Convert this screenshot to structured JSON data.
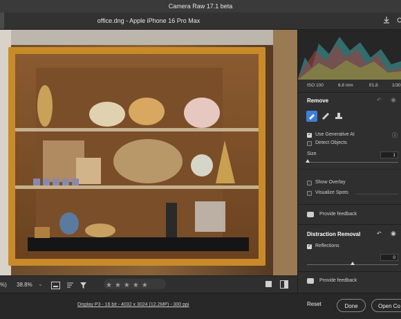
{
  "app": {
    "title": "Camera Raw 17.1 beta"
  },
  "document": {
    "title": "office.dng  -  Apple iPhone 16 Pro Max"
  },
  "exif": {
    "iso": "ISO 100",
    "focal": "6.8 mm",
    "aperture": "f/1.8",
    "shutter": "1/30"
  },
  "remove": {
    "title": "Remove",
    "use_generative_ai": "Use Generative AI",
    "detect_objects": "Detect Objects",
    "size_label": "Size",
    "size_value": "1",
    "show_overlay": "Show Overlay",
    "visualize_spots": "Visualize Spots",
    "feedback": "Provide feedback"
  },
  "distraction": {
    "title": "Distraction Removal",
    "reflections": "Reflections",
    "reflections_value": "0",
    "feedback": "Provide feedback"
  },
  "toolbar": {
    "zoom_partial": "%)",
    "zoom": "38.8%"
  },
  "rating": {
    "stars": "★★★★★"
  },
  "status": {
    "info": "Display P3 - 16 bit - 4032 x 3024 (12.2MP) - 300 ppi",
    "reset": "Reset",
    "done": "Done",
    "open": "Open Co"
  },
  "colors": {
    "accent": "#3d7fd9",
    "panel": "#2f2f2f"
  }
}
